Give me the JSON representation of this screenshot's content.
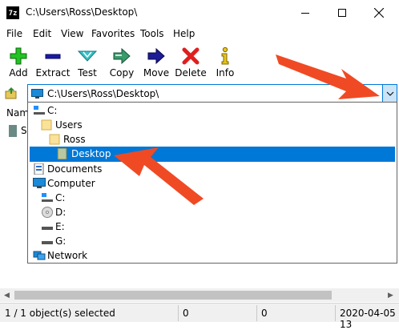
{
  "window": {
    "title": "C:\\Users\\Ross\\Desktop\\",
    "app_icon_text": "7z"
  },
  "menu": [
    "File",
    "Edit",
    "View",
    "Favorites",
    "Tools",
    "Help"
  ],
  "toolbar": {
    "add": "Add",
    "extract": "Extract",
    "test": "Test",
    "copy": "Copy",
    "move": "Move",
    "delete": "Delete",
    "info": "Info"
  },
  "address": {
    "value": "C:\\Users\\Ross\\Desktop\\"
  },
  "file_list": {
    "name_header": "Nam",
    "item_partial": "Sa"
  },
  "dropdown": {
    "items": [
      {
        "label": "C:",
        "icon": "drive-icon"
      },
      {
        "label": "Users",
        "icon": "folder-icon"
      },
      {
        "label": "Ross",
        "icon": "folder-icon"
      },
      {
        "label": "Desktop",
        "icon": "desktop-folder-icon",
        "selected": true
      },
      {
        "label": "Documents",
        "icon": "documents-icon"
      },
      {
        "label": "Computer",
        "icon": "computer-icon"
      },
      {
        "label": "C:",
        "icon": "drive-icon"
      },
      {
        "label": "D:",
        "icon": "cd-drive-icon"
      },
      {
        "label": "E:",
        "icon": "drive-icon"
      },
      {
        "label": "G:",
        "icon": "drive-icon"
      },
      {
        "label": "Network",
        "icon": "network-icon"
      }
    ]
  },
  "status": {
    "selected": "1 / 1 object(s) selected",
    "size1": "0",
    "size2": "0",
    "date": "2020-04-05 13"
  },
  "colors": {
    "accent": "#0078d7",
    "annotation_arrow": "#f04a24"
  }
}
